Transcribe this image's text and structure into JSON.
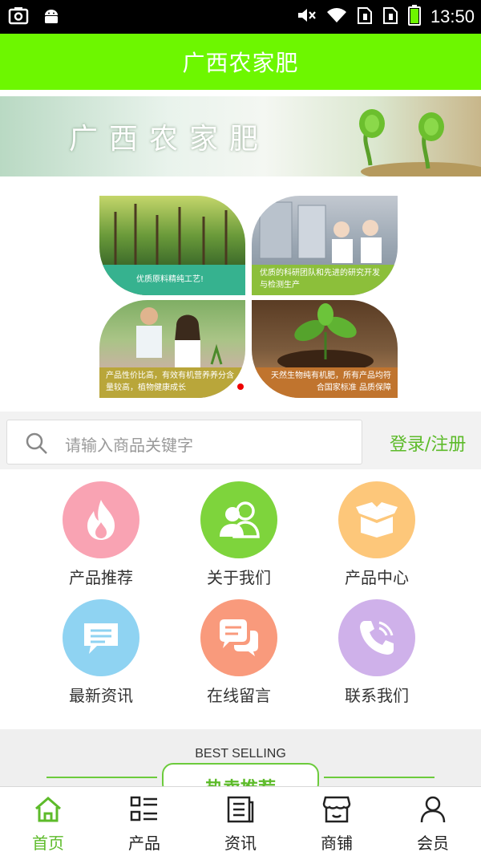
{
  "status_bar": {
    "time": "13:50",
    "icons": [
      "screenshot-icon",
      "android-icon",
      "mute-icon",
      "wifi-icon",
      "sim1-icon",
      "sim2-icon",
      "battery-icon"
    ]
  },
  "app_bar": {
    "title": "广西农家肥"
  },
  "banner": {
    "text": "广西农家肥"
  },
  "hero": {
    "captions": [
      "优质原料精纯工艺!",
      "优质的科研团队和先进的研究开发与检测生产",
      "产品性价比高，有效有机营养养分含量较高，植物健康成长",
      "天然生物纯有机肥，所有产品均符合国家标准 品质保障"
    ]
  },
  "search": {
    "placeholder": "请输入商品关键字",
    "login_label": "登录/注册"
  },
  "grid": {
    "items": [
      {
        "label": "产品推荐",
        "icon": "flame-icon",
        "color": "#f9a3b3"
      },
      {
        "label": "关于我们",
        "icon": "users-icon",
        "color": "#7ed43c"
      },
      {
        "label": "产品中心",
        "icon": "box-icon",
        "color": "#fdc77a"
      },
      {
        "label": "最新资讯",
        "icon": "message-icon",
        "color": "#8fd3f2"
      },
      {
        "label": "在线留言",
        "icon": "chat-icon",
        "color": "#f99a7c"
      },
      {
        "label": "联系我们",
        "icon": "phone-icon",
        "color": "#cfb1ea"
      }
    ]
  },
  "best_selling": {
    "en": "BEST SELLING",
    "zh": "热卖推荐"
  },
  "tabs": [
    {
      "label": "首页",
      "icon": "home-icon",
      "active": true
    },
    {
      "label": "产品",
      "icon": "list-icon",
      "active": false
    },
    {
      "label": "资讯",
      "icon": "news-icon",
      "active": false
    },
    {
      "label": "商铺",
      "icon": "shop-icon",
      "active": false
    },
    {
      "label": "会员",
      "icon": "user-icon",
      "active": false
    }
  ],
  "colors": {
    "accent": "#6df700",
    "link": "#5dbb2a"
  }
}
